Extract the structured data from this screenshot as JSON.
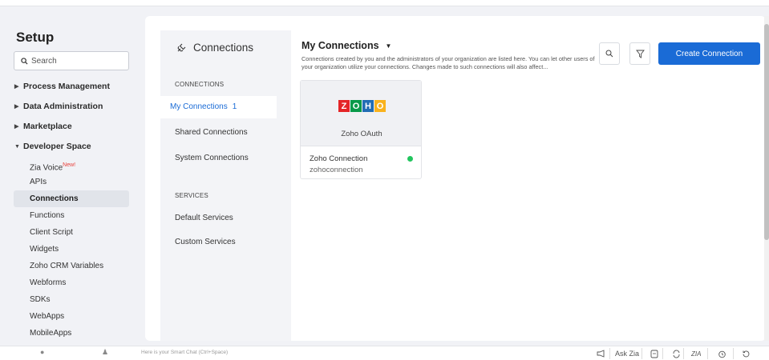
{
  "setup": {
    "title": "Setup",
    "search_placeholder": "Search",
    "tree": [
      {
        "label": "Process Management",
        "expanded": false
      },
      {
        "label": "Data Administration",
        "expanded": false
      },
      {
        "label": "Marketplace",
        "expanded": false
      },
      {
        "label": "Developer Space",
        "expanded": true
      }
    ],
    "dev_items": [
      {
        "label": "Zia Voice",
        "badge": "New!"
      },
      {
        "label": "APIs"
      },
      {
        "label": "Connections",
        "active": true
      },
      {
        "label": "Functions"
      },
      {
        "label": "Client Script"
      },
      {
        "label": "Widgets"
      },
      {
        "label": "Zoho CRM Variables"
      },
      {
        "label": "Webforms"
      },
      {
        "label": "SDKs"
      },
      {
        "label": "WebApps"
      },
      {
        "label": "MobileApps"
      }
    ]
  },
  "connections_nav": {
    "title": "Connections",
    "connections_heading": "CONNECTIONS",
    "my_connections": "My Connections",
    "my_connections_count": "1",
    "shared": "Shared Connections",
    "system": "System Connections",
    "services_heading": "SERVICES",
    "default_services": "Default Services",
    "custom_services": "Custom Services"
  },
  "main": {
    "heading": "My Connections",
    "description": "Connections created by you and the administrators of your organization are listed here. You can let other users of your organization utilize your connections. Changes made to such connections will also affect...",
    "create_button": "Create Connection"
  },
  "card": {
    "logo_letters": [
      "Z",
      "O",
      "H",
      "O"
    ],
    "provider": "Zoho OAuth",
    "name": "Zoho Connection",
    "link_name": "zohoconnection",
    "status_color": "#22c55e"
  },
  "bottombar": {
    "chat_hint": "Here is your Smart Chat (Ctrl+Space)",
    "ask_zia": "Ask Zia"
  },
  "colors": {
    "accent": "#1a6bd6",
    "logo": [
      "#e42527",
      "#089949",
      "#226db4",
      "#f9b21d"
    ]
  }
}
